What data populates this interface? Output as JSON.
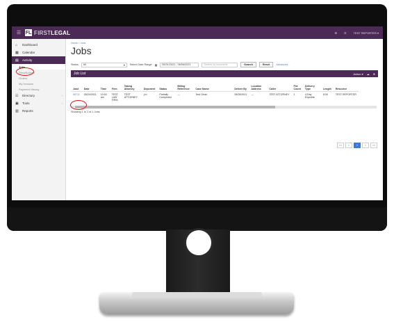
{
  "app": {
    "logo_mark": "FL",
    "logo_first": "FIRST",
    "logo_second": "LEGAL",
    "phone_icon": "phone-icon",
    "user_label": "TEST REPORTER ▾"
  },
  "sidebar": {
    "items": [
      {
        "label": "Dashboard",
        "icon": "home-icon"
      },
      {
        "label": "Calendar",
        "icon": "calendar-icon"
      },
      {
        "label": "Activity",
        "icon": "activity-icon"
      },
      {
        "label": "Directory",
        "icon": "directory-icon"
      },
      {
        "label": "Tools",
        "icon": "tools-icon"
      },
      {
        "label": "Reports",
        "icon": "reports-icon"
      }
    ],
    "sub_items": [
      "Jobs",
      "Files/Notices",
      "Orders",
      "My Invoices",
      "Payment History"
    ]
  },
  "main": {
    "breadcrumb": "Home > Jobs",
    "title": "Jobs",
    "filters": {
      "status_label": "Status",
      "status_value": "All",
      "date_range_label": "Select Date Range",
      "date_range_value": "05/31/2021 - 06/06/2021",
      "search_placeholder": "Search by keywords",
      "search_button": "Search",
      "reset_button": "Reset",
      "advanced_link": "Advanced..."
    },
    "panel": {
      "title": "Job List",
      "action_label": "Action ▾"
    },
    "table": {
      "headers": [
        "Job#",
        "Date",
        "Time",
        "Firm",
        "Taking Attorney",
        "Deponent",
        "Status",
        "Billing Reference",
        "Case Name",
        "Deliver By",
        "Location Address",
        "Caller",
        "File Count",
        "Delivery Type",
        "Length",
        "Resource"
      ],
      "rows": [
        [
          "56711",
          "05/24/2021",
          "10:00 am",
          "TEST LAW FIRM",
          "TEST ATTORNEY",
          "j.m",
          "Partially Completed",
          "---",
          "Test Cihan",
          "05/28/2021",
          "---",
          "TEST ATTORNEY",
          "1",
          "4-Day Expedite",
          "8:00",
          "TEST REPORTER"
        ]
      ]
    },
    "showing": "Showing 1 to 1 of 1 Jobs",
    "pager": [
      "<<",
      "<",
      "1",
      ">",
      ">>"
    ]
  }
}
